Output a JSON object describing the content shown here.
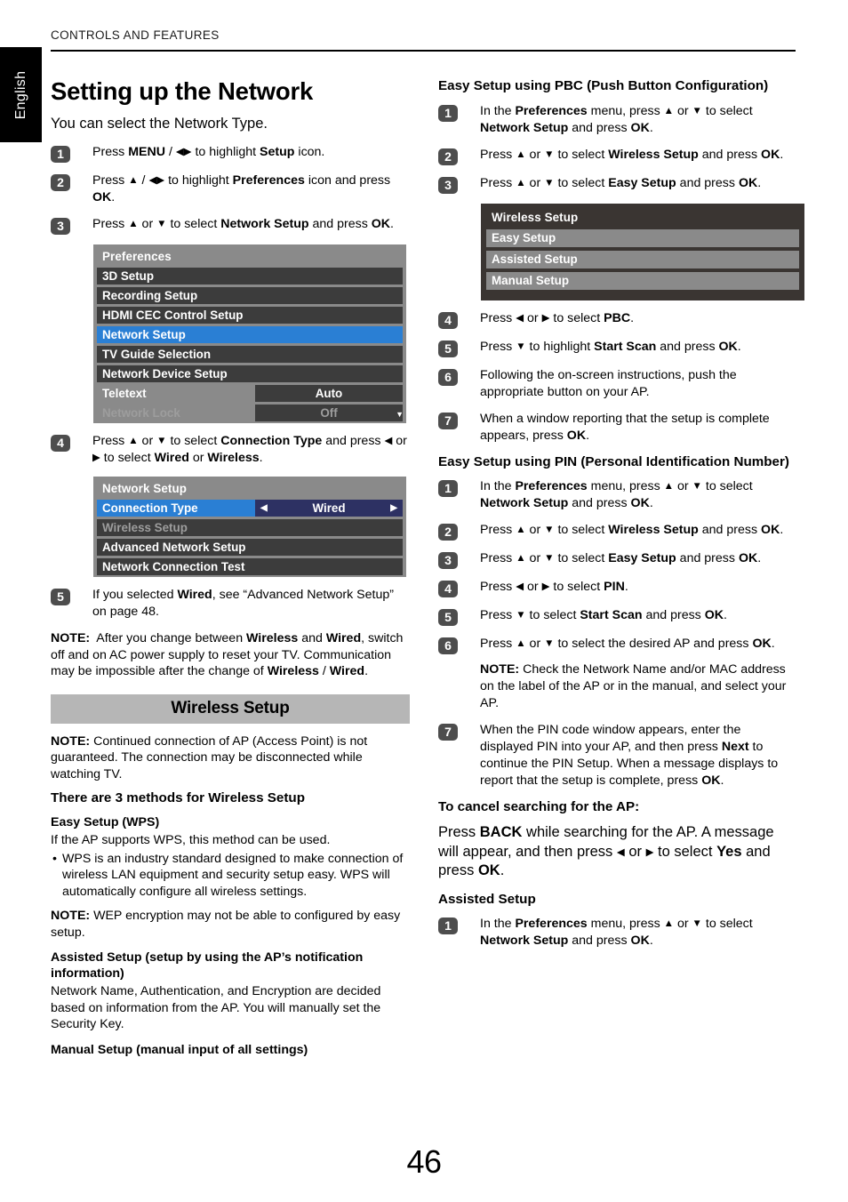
{
  "header": {
    "running_head": "CONTROLS AND FEATURES",
    "language_tab": "English"
  },
  "page_number": "46",
  "left_column": {
    "title": "Setting up the Network",
    "intro": "You can select the Network Type.",
    "steps_top": [
      {
        "num": "1",
        "text_html": "Press <b>MENU</b> / <span class=\"ar\">◀▶</span> to highlight <b>Setup</b> icon."
      },
      {
        "num": "2",
        "text_html": "Press <span class=\"ar\">▲</span> / <span class=\"ar\">◀▶</span> to highlight <b>Preferences</b> icon and press <b>OK</b>."
      },
      {
        "num": "3",
        "text_html": "Press <span class=\"ar\">▲</span> or <span class=\"ar\">▼</span> to select <b>Network Setup</b> and press <b>OK</b>."
      }
    ],
    "preferences_menu": {
      "title": "Preferences",
      "rows": [
        {
          "label": "3D Setup",
          "value": "",
          "state": "normal"
        },
        {
          "label": "Recording Setup",
          "value": "",
          "state": "normal"
        },
        {
          "label": "HDMI CEC Control Setup",
          "value": "",
          "state": "normal"
        },
        {
          "label": "Network Setup",
          "value": "",
          "state": "selected"
        },
        {
          "label": "TV Guide Selection",
          "value": "",
          "state": "normal"
        },
        {
          "label": "Network Device Setup",
          "value": "",
          "state": "normal"
        },
        {
          "label": "Teletext",
          "value": "Auto",
          "state": "normal"
        },
        {
          "label": "Network Lock",
          "value": "Off",
          "state": "dim"
        }
      ],
      "scroll_indicator": "▼"
    },
    "step_4": {
      "num": "4",
      "text_html": "Press <span class=\"ar\">▲</span> or <span class=\"ar\">▼</span> to select <b>Connection Type</b> and press <span class=\"ar\">◀</span> or <span class=\"ar\">▶</span> to select <b>Wired</b> or <b>Wireless</b>."
    },
    "network_setup_menu": {
      "title": "Network Setup",
      "rows": [
        {
          "label": "Connection Type",
          "value": "Wired",
          "state": "selected",
          "caret_left": "◀",
          "caret_right": "▶"
        },
        {
          "label": "Wireless Setup",
          "value": "",
          "state": "dim"
        },
        {
          "label": "Advanced Network Setup",
          "value": "",
          "state": "normal"
        },
        {
          "label": "Network Connection Test",
          "value": "",
          "state": "normal"
        }
      ]
    },
    "step_5": {
      "num": "5",
      "text_html": "If you selected <b>Wired</b>, see “Advanced Network Setup” on page 48."
    },
    "note_1_html": "<b>NOTE:</b>&nbsp; After you change between <b>Wireless</b> and <b>Wired</b>, switch off and on AC power supply to reset your TV. Communication may be impossible after the change of <b>Wireless</b> / <b>Wired</b>.",
    "banner": "Wireless Setup",
    "note_2_html": "<b>NOTE:</b> Continued connection of AP (Access Point) is not guaranteed. The connection may be disconnected while watching TV.",
    "methods_heading": "There are 3 methods for Wireless Setup",
    "method_1_heading": "Easy Setup (WPS)",
    "method_1_body": "If the AP supports WPS, this method can be used.",
    "method_1_bullet": "WPS is an industry standard designed to make connection of wireless LAN equipment and security setup easy. WPS will automatically configure all wireless settings.",
    "note_3_html": "<b>NOTE:</b> WEP encryption may not be able to configured by easy setup.",
    "method_2_heading": "Assisted Setup (setup by using the AP’s notification information)",
    "method_2_body": "Network Name, Authentication, and Encryption are decided based on information from the AP. You will manually set the Security Key.",
    "method_3_heading": "Manual Setup (manual input of all settings)"
  },
  "right_column": {
    "pbc_heading": "Easy Setup using PBC (Push Button Configuration)",
    "pbc_steps_top": [
      {
        "num": "1",
        "text_html": "In the <b>Preferences</b> menu, press <span class=\"ar\">▲</span> or <span class=\"ar\">▼</span> to select <b>Network Setup</b> and press <b>OK</b>."
      },
      {
        "num": "2",
        "text_html": "Press <span class=\"ar\">▲</span> or <span class=\"ar\">▼</span> to select <b>Wireless Setup</b> and press <b>OK</b>."
      },
      {
        "num": "3",
        "text_html": "Press <span class=\"ar\">▲</span> or <span class=\"ar\">▼</span> to select <b>Easy Setup</b> and press <b>OK</b>."
      }
    ],
    "wireless_setup_menu": {
      "title": "Wireless Setup",
      "rows": [
        {
          "label": "Easy Setup",
          "state": "selected"
        },
        {
          "label": "Assisted Setup",
          "state": "normal"
        },
        {
          "label": "Manual Setup",
          "state": "normal"
        }
      ]
    },
    "pbc_steps_bottom": [
      {
        "num": "4",
        "text_html": "Press <span class=\"ar\">◀</span> or <span class=\"ar\">▶</span> to select <b>PBC</b>."
      },
      {
        "num": "5",
        "text_html": "Press <span class=\"ar\">▼</span> to highlight <b>Start Scan</b> and press <b>OK</b>."
      },
      {
        "num": "6",
        "text_html": "Following the on-screen instructions, push the appropriate button on your AP."
      },
      {
        "num": "7",
        "text_html": "When a window reporting that the setup is complete appears, press <b>OK</b>."
      }
    ],
    "pin_heading": "Easy Setup using PIN (Personal Identification Number)",
    "pin_steps": [
      {
        "num": "1",
        "text_html": "In the <b>Preferences</b> menu, press <span class=\"ar\">▲</span> or <span class=\"ar\">▼</span> to select <b>Network Setup</b> and press <b>OK</b>."
      },
      {
        "num": "2",
        "text_html": "Press <span class=\"ar\">▲</span> or <span class=\"ar\">▼</span> to select <b>Wireless Setup</b> and press <b>OK</b>."
      },
      {
        "num": "3",
        "text_html": "Press <span class=\"ar\">▲</span> or <span class=\"ar\">▼</span> to select <b>Easy Setup</b> and press <b>OK</b>."
      },
      {
        "num": "4",
        "text_html": "Press <span class=\"ar\">◀</span> or <span class=\"ar\">▶</span> to select <b>PIN</b>."
      },
      {
        "num": "5",
        "text_html": "Press <span class=\"ar\">▼</span> to select <b>Start Scan</b> and press <b>OK</b>."
      },
      {
        "num": "6",
        "text_html": "Press <span class=\"ar\">▲</span> or <span class=\"ar\">▼</span> to select the desired AP and press <b>OK</b>.",
        "note_html": "<b>NOTE:</b> Check the Network Name and/or MAC address on the label of the AP or in the manual, and select your AP."
      },
      {
        "num": "7",
        "text_html": "When the PIN code window appears, enter the displayed PIN into your AP, and then press <b>Next</b> to continue the PIN Setup. When a message displays to report that the setup is complete, press <b>OK</b>."
      }
    ],
    "cancel_heading": "To cancel searching for the AP:",
    "cancel_body_html": "Press <b>BACK</b> while searching for the AP. A message will appear, and then press <span class=\"ar\">◀</span> or <span class=\"ar\">▶</span> to select <b>Yes</b> and press <b>OK</b>.",
    "assisted_heading": "Assisted Setup",
    "assisted_steps": [
      {
        "num": "1",
        "text_html": "In the <b>Preferences</b> menu, press <span class=\"ar\">▲</span> or <span class=\"ar\">▼</span> to select <b>Network Setup</b> and press <b>OK</b>."
      }
    ]
  },
  "colors": {
    "highlight_blue": "#2a7fd4",
    "menu_gray": "#8a8a8a",
    "menu_row_dark": "#3c3c3c",
    "menu_value_navy": "#2d3163",
    "banner_gray": "#b6b6b6",
    "badge_gray": "#4d4d4d"
  }
}
